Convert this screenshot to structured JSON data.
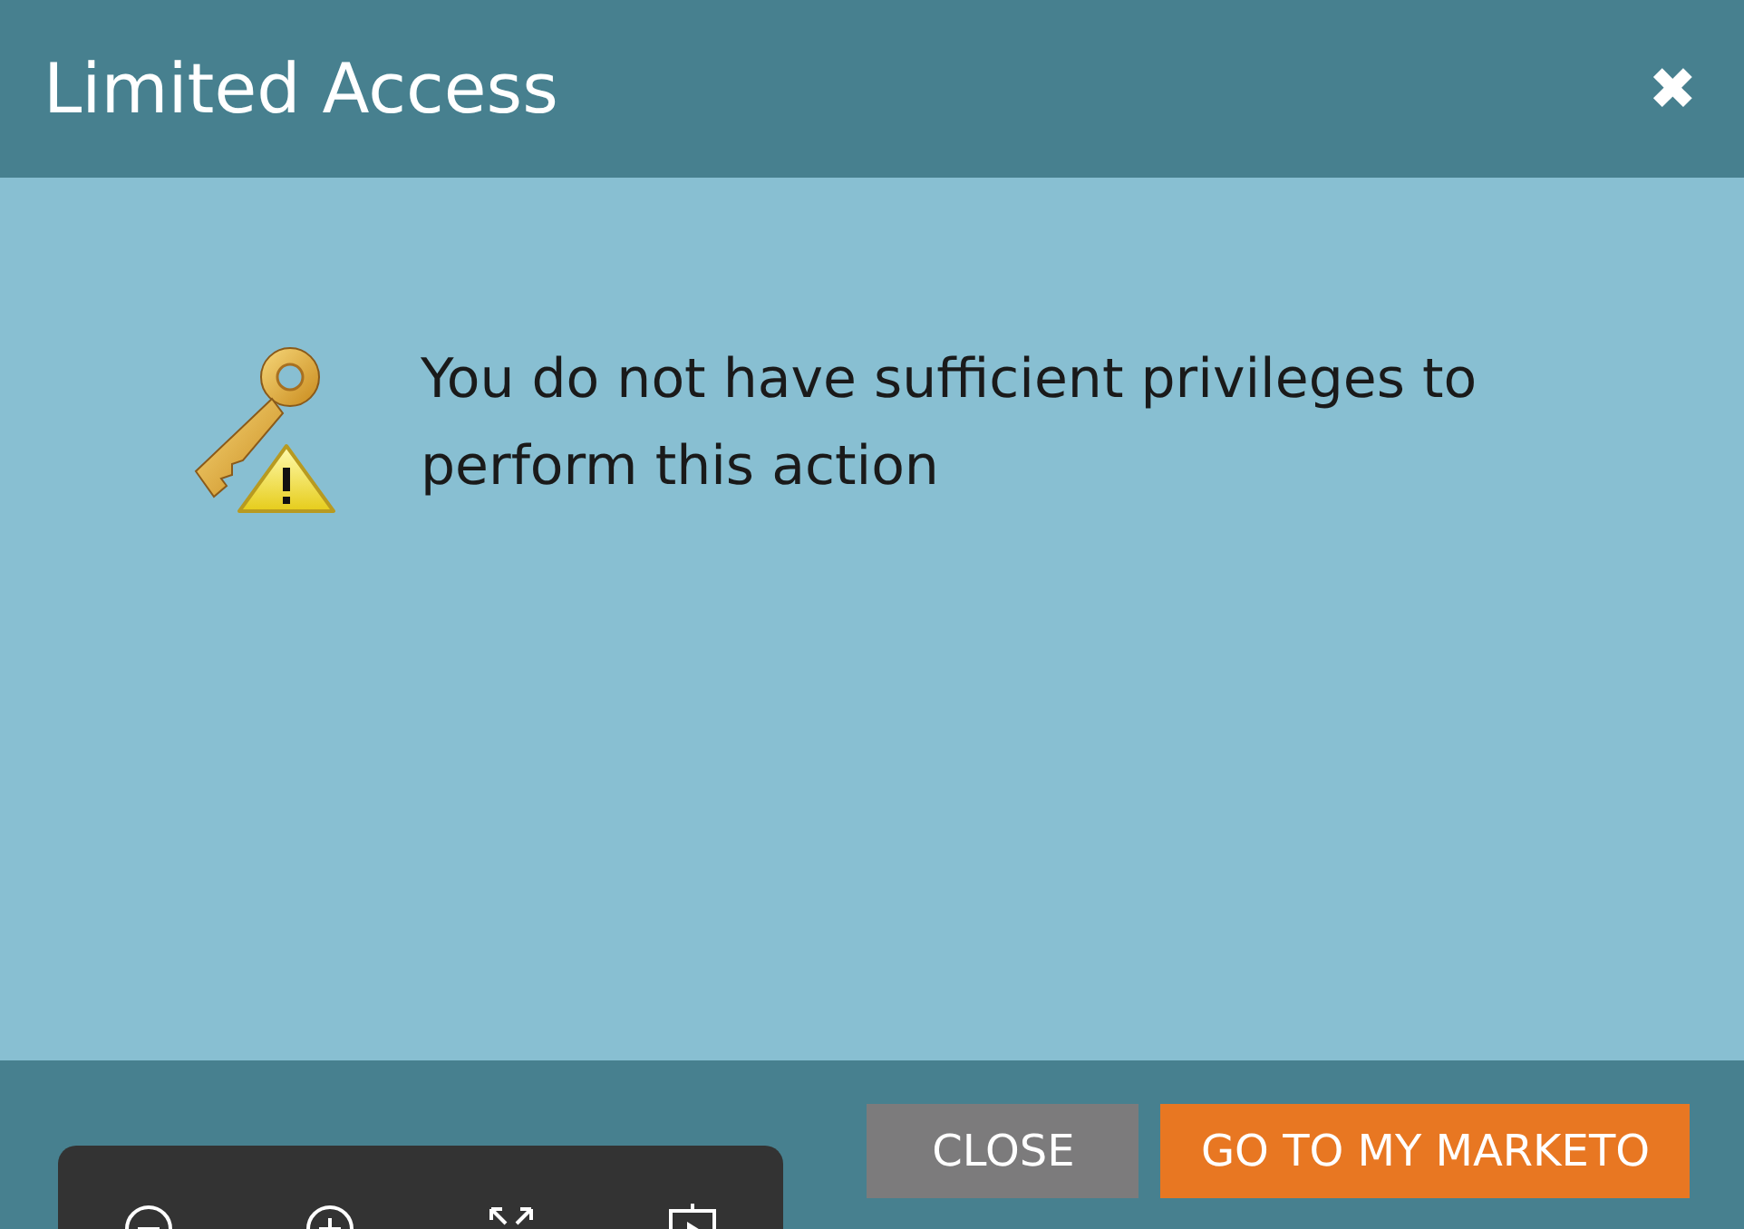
{
  "dialog": {
    "title": "Limited Access",
    "close_glyph": "✖",
    "message": "You do not have sufficient privileges to perform this action",
    "buttons": [
      {
        "label": "CLOSE",
        "kind": "secondary"
      },
      {
        "label": "GO TO MY MARKETO",
        "kind": "primary"
      }
    ]
  },
  "viewer_toolbar": {
    "tools": [
      {
        "kind": "zoom-out"
      },
      {
        "kind": "zoom-in"
      },
      {
        "kind": "fullscreen"
      },
      {
        "kind": "present"
      }
    ]
  }
}
